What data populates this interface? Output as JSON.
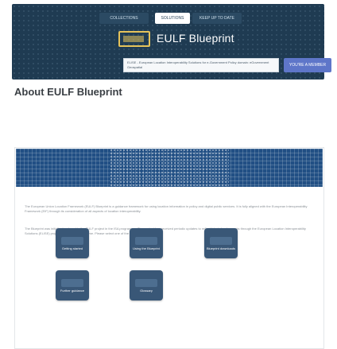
{
  "banner": {
    "nav": [
      {
        "label": "COLLECTIONS"
      },
      {
        "label": "SOLUTIONS"
      },
      {
        "label": "KEEP UP TO DATE"
      }
    ],
    "title": "EULF Blueprint",
    "breadcrumb": "ELISE - European Location Interoperability Solutions for e-Government  Policy domain: eGovernment  Geospatial",
    "member_button": "YOU'RE A MEMBER"
  },
  "page_title": "About EULF Blueprint",
  "body": {
    "para1": "The European Union Location Framework (EULF) Blueprint is a guidance framework for using location information in policy and digital public services. It is fully aligned with the European Interoperability Framework (EIF) through its consideration of all aspects of location interoperability.",
    "para2": "The Blueprint was initially developed in the EULF project in the ISA programme. The content has received periodic updates to reflect latest developments through the European Location Interoperability Solutions (ELISE) project in the ISA² programme. Please select one of the following:"
  },
  "pads": [
    {
      "label": "Getting started"
    },
    {
      "label": "Using the Blueprint"
    },
    {
      "label": "Blueprint downloads"
    },
    {
      "label": "Further guidance"
    },
    {
      "label": "Glossary"
    }
  ],
  "colors": {
    "banner": "#1f3b52",
    "accent_gold": "#e6c35a",
    "member_button": "#5e76c9",
    "pad": "#395777",
    "hero": "#214f84"
  }
}
